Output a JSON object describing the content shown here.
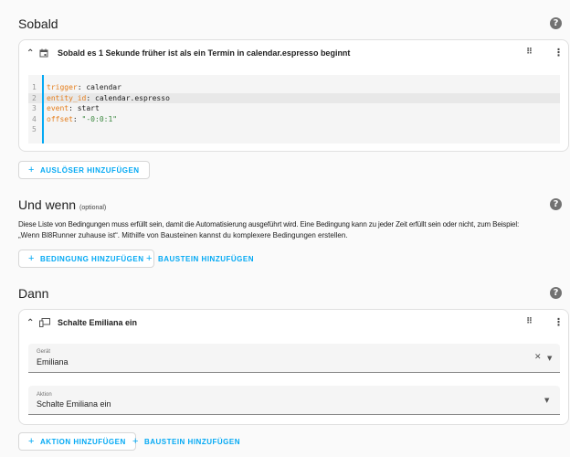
{
  "trigger_section": {
    "title": "Sobald",
    "card": {
      "header": "Sobald es 1 Sekunde früher ist als ein Termin in calendar.espresso beginnt",
      "code_lines": [
        {
          "num": "1",
          "key": "trigger",
          "sep": ": ",
          "value": "calendar",
          "value_style": "plain"
        },
        {
          "num": "2",
          "key": "entity_id",
          "sep": ": ",
          "value": "calendar.espresso",
          "value_style": "plain"
        },
        {
          "num": "3",
          "key": "event",
          "sep": ": ",
          "value": "start",
          "value_style": "plain"
        },
        {
          "num": "4",
          "key": "offset",
          "sep": ": ",
          "value": "\"-0:0:1\"",
          "value_style": "string"
        },
        {
          "num": "5",
          "key": "",
          "sep": "",
          "value": "",
          "value_style": "plain"
        }
      ]
    },
    "add_button": "AUSLÖSER HINZUFÜGEN"
  },
  "condition_section": {
    "title": "Und wenn",
    "optional_label": "(optional)",
    "description_line1": "Diese Liste von Bedingungen muss erfüllt sein, damit die Automatisierung ausgeführt wird. Eine Bedingung kann zu jeder Zeit erfüllt sein oder nicht, zum Beispiel:",
    "description_line2": "„Wenn Bl8Runner zuhause ist“. Mithilfe von Bausteinen kannst du komplexere Bedingungen erstellen.",
    "add_condition_button": "BEDINGUNG HINZUFÜGEN",
    "add_block_button": "BAUSTEIN HINZUFÜGEN"
  },
  "action_section": {
    "title": "Dann",
    "card": {
      "header": "Schalte Emiliana ein",
      "device_field": {
        "label": "Gerät",
        "value": "Emiliana"
      },
      "action_field": {
        "label": "Aktion",
        "value": "Schalte Emiliana ein"
      }
    },
    "add_action_button": "AKTION HINZUFÜGEN",
    "add_block_button": "BAUSTEIN HINZUFÜGEN"
  },
  "icons": {
    "help": "?",
    "chevron_up": "⌃",
    "calendar": "calendar-icon",
    "device": "device-icon",
    "more": "⋮",
    "drag": "⠿",
    "clear": "✕",
    "dropdown": "▼",
    "plus": "+"
  },
  "colors": {
    "accent": "#03a9f4",
    "code_border": "#03a9f4",
    "yaml_key": "#e57d1a",
    "yaml_string": "#3a873e"
  }
}
